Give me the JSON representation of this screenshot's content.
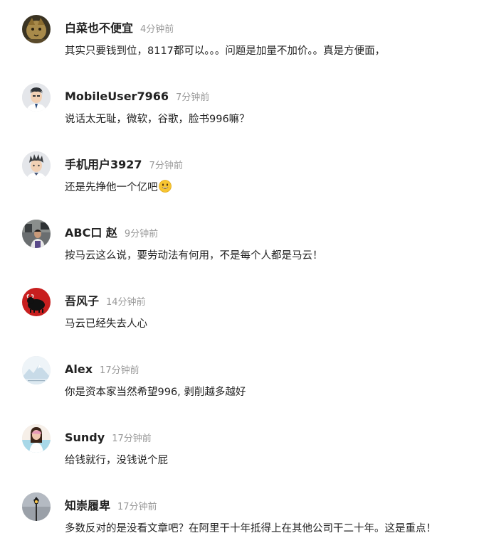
{
  "comments": [
    {
      "username": "白菜也不便宜",
      "time": "4分钟前",
      "text": "其实只要钱到位，8117都可以。。。问题是加量不加价。。真是方便面，",
      "avatar_icon": "golden-cat-avatar-icon"
    },
    {
      "username": "MobileUser7966",
      "time": "7分钟前",
      "text": "说话太无耻，微软，谷歌，脸书996嘛？",
      "avatar_icon": "default-male-avatar-icon"
    },
    {
      "username": "手机用户3927",
      "time": "7分钟前",
      "text": "还是先挣他一个亿吧",
      "emoji": "grinning-face-emoji-icon",
      "avatar_icon": "default-spiky-hair-avatar-icon"
    },
    {
      "username": "ABC口 赵",
      "time": "9分钟前",
      "text": "按马云这么说，要劳动法有何用，不是每个人都是马云！",
      "avatar_icon": "person-photo-avatar-icon"
    },
    {
      "username": "吾风子",
      "time": "14分钟前",
      "text": "马云已经失去人心",
      "avatar_icon": "red-bull-avatar-icon"
    },
    {
      "username": "Alex",
      "time": "17分钟前",
      "text": "你是资本家当然希望996, 剥削越多越好",
      "avatar_icon": "mountain-landscape-avatar-icon"
    },
    {
      "username": "Sundy",
      "time": "17分钟前",
      "text": "给钱就行，没钱说个屁",
      "avatar_icon": "woman-photo-avatar-icon"
    },
    {
      "username": "知崇履卑",
      "time": "17分钟前",
      "text": "多数反对的是没看文章吧？在阿里干十年抵得上在其他公司干二十年。这是重点！",
      "avatar_icon": "street-lamp-avatar-icon"
    }
  ],
  "colors": {
    "username": "#222222",
    "timestamp": "#999999",
    "body_text": "#222222",
    "background": "#ffffff"
  }
}
